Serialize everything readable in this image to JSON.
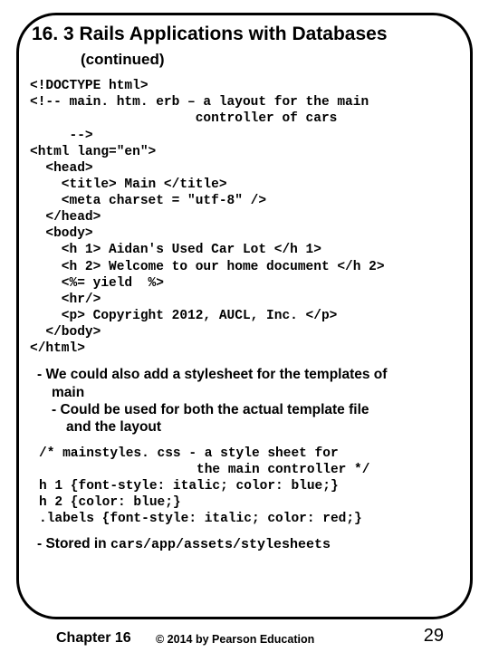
{
  "title": "16. 3 Rails Applications with Databases",
  "subtitle": "(continued)",
  "code1": "<!DOCTYPE html>\n<!-- main. htm. erb – a layout for the main\n                     controller of cars\n     -->\n<html lang=\"en\">\n  <head>\n    <title> Main </title>\n    <meta charset = \"utf-8\" />\n  </head>\n  <body>\n    <h 1> Aidan's Used Car Lot </h 1>\n    <h 2> Welcome to our home document </h 2>\n    <%= yield  %>\n    <hr/>\n    <p> Copyright 2012, AUCL, Inc. </p>\n  </body>\n</html>",
  "bullets": {
    "b1a": "- We could also add a stylesheet for the templates of",
    "b1a_cont": "main",
    "b2a": "- Could be used for both the actual template file",
    "b2a_cont": "and the layout"
  },
  "code2": "/* mainstyles. css - a style sheet for\n                    the main controller */\nh 1 {font-style: italic; color: blue;}\nh 2 {color: blue;}\n.labels {font-style: italic; color: red;}",
  "stored_label": "- Stored in ",
  "stored_path": "cars/app/assets/stylesheets",
  "footer": {
    "chapter": "Chapter 16",
    "copyright": "© 2014 by Pearson Education",
    "pagenum": "29"
  }
}
